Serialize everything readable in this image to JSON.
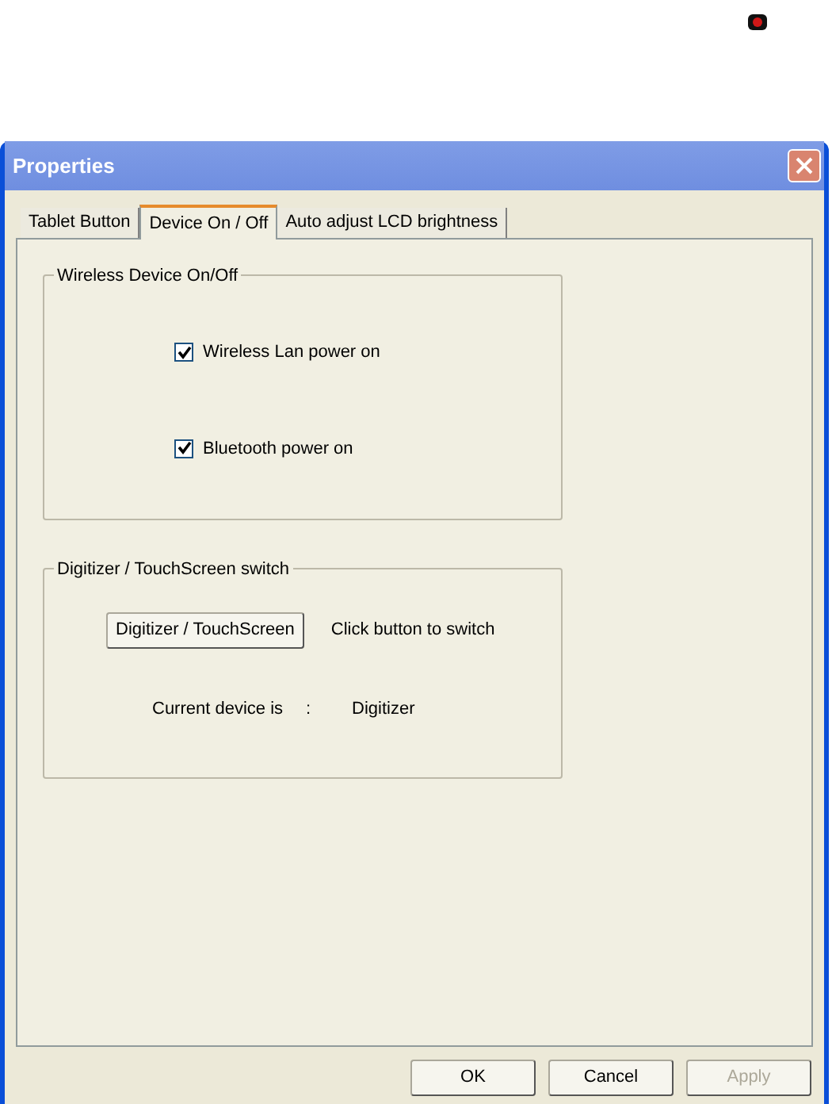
{
  "window": {
    "title": "Properties"
  },
  "tabs": [
    {
      "label": "Tablet Button",
      "selected": false
    },
    {
      "label": "Device On / Off",
      "selected": true
    },
    {
      "label": "Auto adjust LCD brightness",
      "selected": false
    }
  ],
  "wireless_group": {
    "title": "Wireless Device On/Off",
    "checkboxes": [
      {
        "label": "Wireless Lan power on",
        "checked": true
      },
      {
        "label": "Bluetooth power on",
        "checked": true
      }
    ]
  },
  "digitizer_group": {
    "title": "Digitizer / TouchScreen switch",
    "button": "Digitizer / TouchScreen",
    "hint": "Click button to switch",
    "current_label": "Current device is",
    "separator": ":",
    "current_value": "Digitizer"
  },
  "buttons": [
    {
      "label": "OK",
      "disabled": false
    },
    {
      "label": "Cancel",
      "disabled": false
    },
    {
      "label": "Apply",
      "disabled": true
    }
  ]
}
